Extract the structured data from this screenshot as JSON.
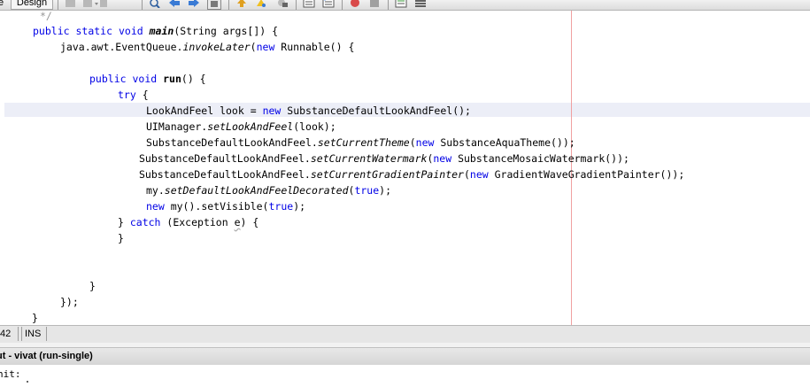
{
  "tabs": {
    "source_label": "e",
    "design_label": "Design"
  },
  "toolbar": {
    "icons": [
      "grayed-tool-icon",
      "grayed-dropdown-icon",
      "search-icon",
      "back-arrow-icon",
      "forward-arrow-icon",
      "toggle-bookmark-icon",
      "up-arrow-icon",
      "highlight-icon",
      "comment-icon",
      "shift-left-icon",
      "shift-right-icon",
      "record-macro-icon",
      "stop-macro-icon",
      "comment-lines-icon",
      "uncomment-lines-icon"
    ],
    "accent": "#d94a4a"
  },
  "editor": {
    "comment_end": "*/",
    "l_main": {
      "a": "public",
      "b": "static",
      "c": "void",
      "m": "main",
      "rest": "(String args[]) {"
    },
    "l_invoke": {
      "a": "java.awt.EventQueue.",
      "m": "invokeLater",
      "b": "(",
      "kw": "new",
      "rest": " Runnable() {"
    },
    "l_run": {
      "a": "public",
      "b": "void",
      "m": "run",
      "rest": "() {"
    },
    "l_try": {
      "kw": "try",
      "rest": " {"
    },
    "l_look": {
      "a": "LookAndFeel look = ",
      "kw": "new",
      "rest": " SubstanceDefaultLookAndFeel();"
    },
    "l_setlaf": {
      "a": "UIManager.",
      "m": "setLookAndFeel",
      "rest": "(look);"
    },
    "l_theme": {
      "a": "SubstanceDefaultLookAndFeel.",
      "m": "setCurrentTheme",
      "b": "(",
      "kw": "new",
      "rest": " SubstanceAquaTheme());"
    },
    "l_watermark": {
      "a": "SubstanceDefaultLookAndFeel.",
      "m": "setCurrentWatermark",
      "b": "(",
      "kw": "new",
      "rest": " SubstanceMosaicWatermark());"
    },
    "l_gradient": {
      "a": "SubstanceDefaultLookAndFeel.",
      "m": "setCurrentGradientPainter",
      "b": "(",
      "kw": "new",
      "rest": " GradientWaveGradientPainter());"
    },
    "l_decorated": {
      "a": "my.",
      "m": "setDefaultLookAndFeelDecorated",
      "b": "(",
      "kw": "true",
      "rest": ");"
    },
    "l_visible": {
      "kw": "new",
      "a": " my().setVisible(",
      "kw2": "true",
      "rest": ");"
    },
    "l_catch": {
      "a": "} ",
      "kw": "catch",
      "b": " (Exception ",
      "v": "e",
      "rest": ") {"
    },
    "l_close1": "}",
    "l_close2": "}",
    "l_close3": "});",
    "l_close4": "}"
  },
  "status": {
    "line": "42",
    "mode": "INS"
  },
  "output": {
    "title": "ut - vivat (run-single)",
    "line1": "nit:"
  }
}
